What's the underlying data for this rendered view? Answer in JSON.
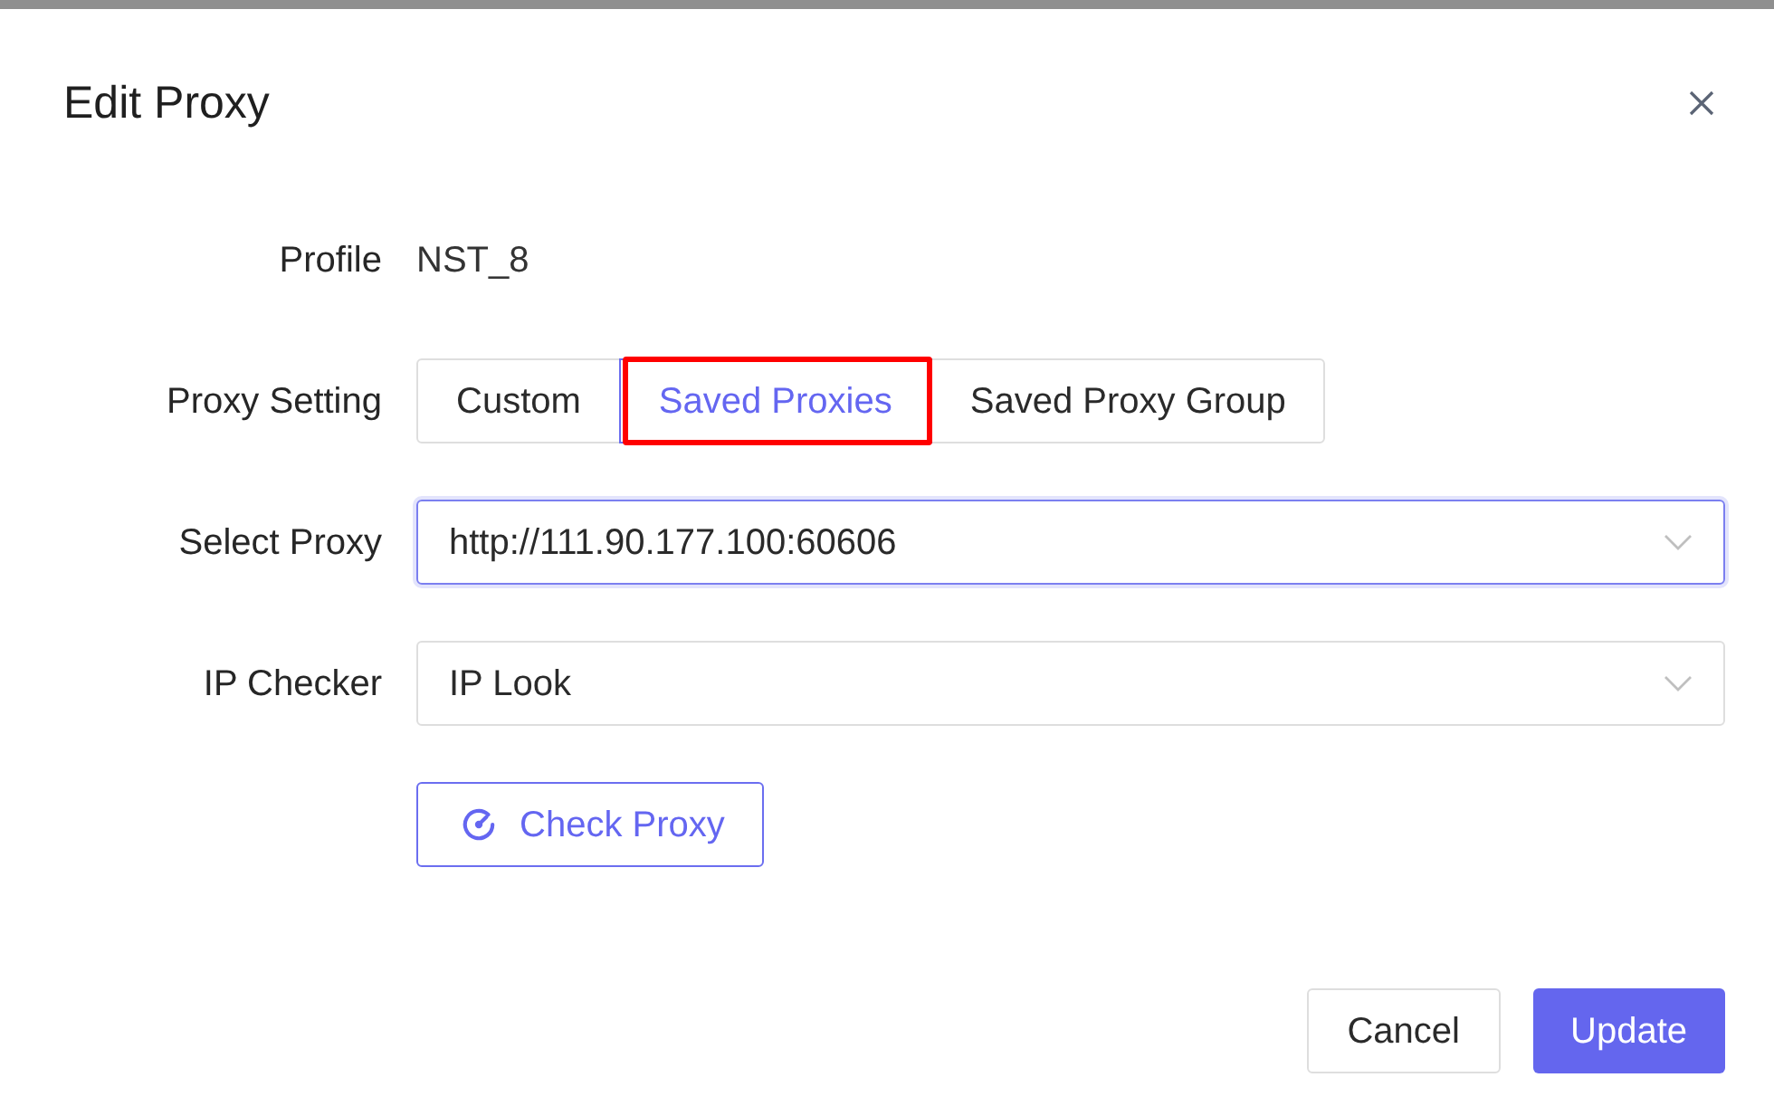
{
  "dialog": {
    "title": "Edit Proxy"
  },
  "fields": [
    {
      "kind": "text",
      "label": "Profile",
      "value": "NST_8"
    },
    {
      "kind": "segmented",
      "label": "Proxy Setting",
      "options": [
        {
          "label": "Custom",
          "selected": false,
          "highlighted": false
        },
        {
          "label": "Saved Proxies",
          "selected": true,
          "highlighted": true
        },
        {
          "label": "Saved Proxy Group",
          "selected": false,
          "highlighted": false
        }
      ]
    },
    {
      "kind": "select",
      "label": "Select Proxy",
      "value": "http://111.90.177.100:60606",
      "focused": true
    },
    {
      "kind": "select",
      "label": "IP Checker",
      "value": "IP Look",
      "focused": false
    },
    {
      "kind": "action",
      "label": "Check Proxy"
    }
  ],
  "footer_buttons": [
    {
      "kind": "secondary",
      "label": "Cancel"
    },
    {
      "kind": "primary",
      "label": "Update"
    }
  ]
}
